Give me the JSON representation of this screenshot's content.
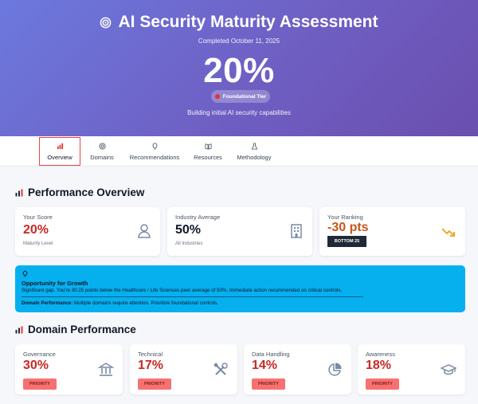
{
  "hero": {
    "title": "AI Security Maturity Assessment",
    "date": "Completed October 11, 2025",
    "score": "20%",
    "tier": "Foundational Tier",
    "subtitle": "Building initial AI security capabilities"
  },
  "tabs": [
    {
      "label": "Overview",
      "icon": "bar-chart-icon",
      "active": true
    },
    {
      "label": "Domains",
      "icon": "target-icon",
      "active": false
    },
    {
      "label": "Recommendations",
      "icon": "lightbulb-icon",
      "active": false
    },
    {
      "label": "Resources",
      "icon": "book-icon",
      "active": false
    },
    {
      "label": "Methodology",
      "icon": "flask-icon",
      "active": false
    }
  ],
  "overview": {
    "title": "Performance Overview",
    "cards": [
      {
        "label": "Your Score",
        "value": "20%",
        "sub": "Maturity Level",
        "icon": "user-icon"
      },
      {
        "label": "Industry Average",
        "value": "50%",
        "sub": "All Industries",
        "icon": "building-icon"
      },
      {
        "label": "Your Ranking",
        "value": "-30 pts",
        "badge": "BOTTOM 25",
        "icon": "trending-down-icon"
      }
    ]
  },
  "alert": {
    "title": "Opportunity for Growth",
    "text": "Significant gap. You're 30.25 points below the Healthcare / Life Sciences peer average of 50%. Immediate action recommended on critical controls.",
    "domain_label": "Domain Performance:",
    "domain_text": "Multiple domains require attention. Prioritize foundational controls."
  },
  "domains": {
    "title": "Domain Performance",
    "items": [
      {
        "label": "Governance",
        "value": "30%",
        "badge": "PRIORITY",
        "icon": "institution-icon"
      },
      {
        "label": "Technical",
        "value": "17%",
        "badge": "PRIORITY",
        "icon": "tools-icon"
      },
      {
        "label": "Data Handling",
        "value": "14%",
        "badge": "PRIORITY",
        "icon": "pie-chart-icon"
      },
      {
        "label": "Awareness",
        "value": "18%",
        "badge": "PRIORITY",
        "icon": "graduation-cap-icon"
      }
    ]
  },
  "colors": {
    "accent_red": "#c62828",
    "alert_bg": "#06b0ef",
    "hero_start": "#6c79de",
    "hero_end": "#6a4fae",
    "trend_icon": "#f0a92a"
  }
}
